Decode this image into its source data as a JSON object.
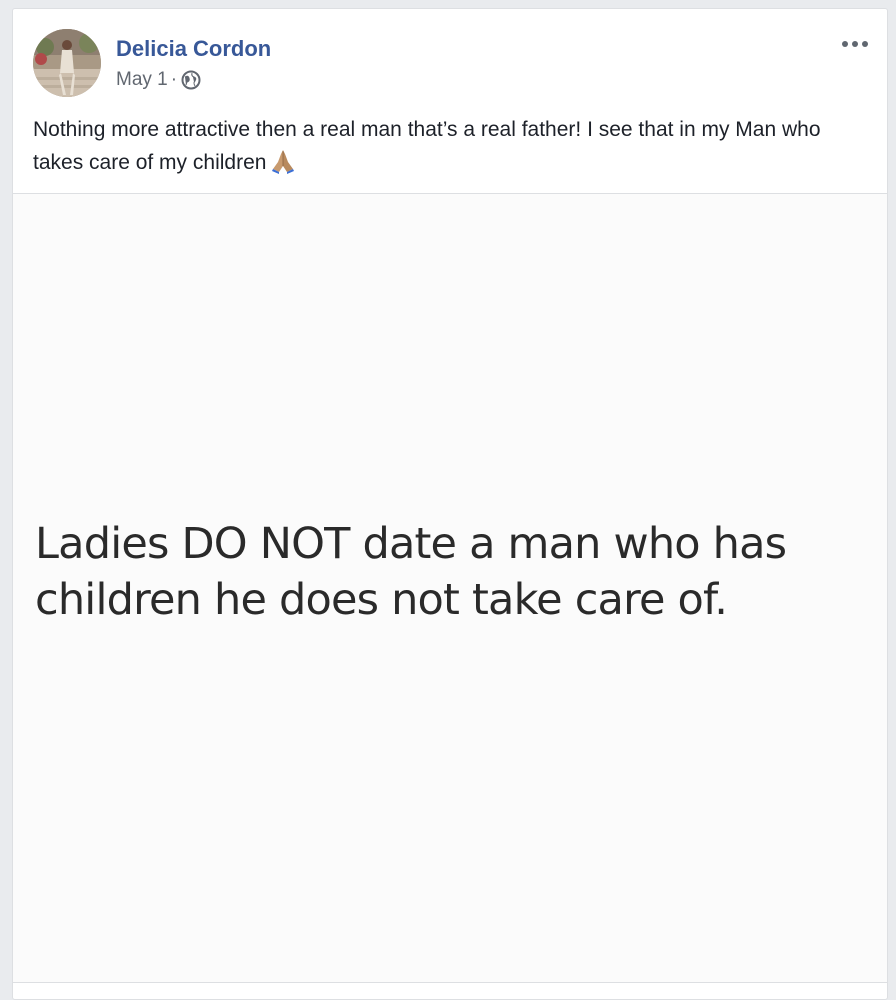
{
  "post": {
    "author": "Delicia Cordon",
    "date": "May 1",
    "separator": "·",
    "privacy_icon": "globe-icon",
    "options_icon": "more-options-icon",
    "text": "Nothing more attractive then a real man that’s a real father! I see that in my Man who takes care of my children",
    "emoji": "folded-hands-icon",
    "image_text": "Ladies DO NOT date a man who has children he does not take care of."
  },
  "colors": {
    "author_link": "#385898",
    "meta_text": "#616770",
    "body_text": "#1d2129"
  }
}
